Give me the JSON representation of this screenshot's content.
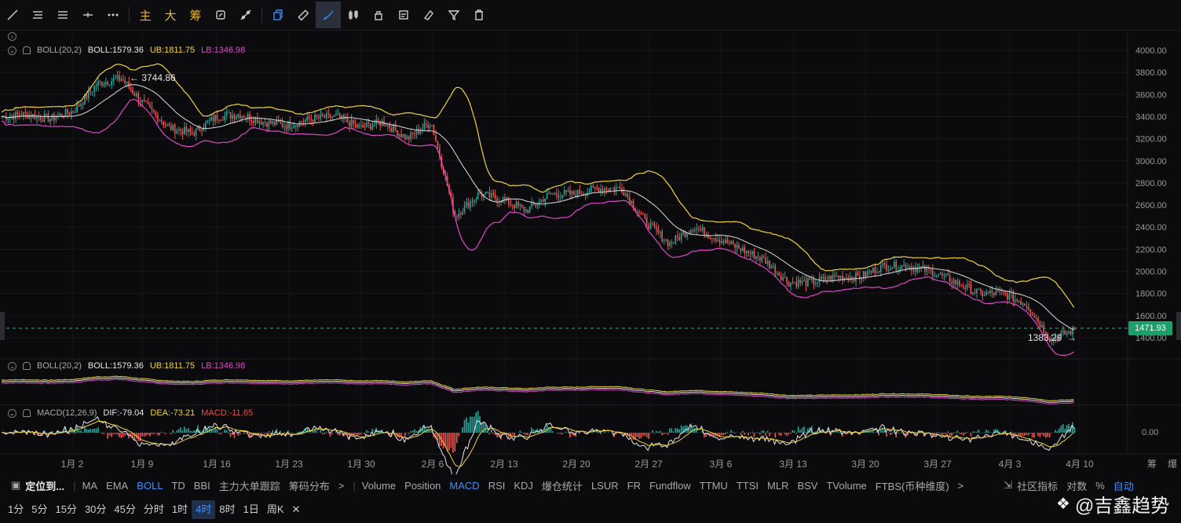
{
  "toolbar": {
    "tools": [
      "trend-line-icon",
      "horizontal-lines-icon",
      "parallel-lines-icon",
      "crosshair-icon",
      "more-dots-icon"
    ],
    "text_tools": [
      "主",
      "大",
      "筹"
    ],
    "right_tools": [
      "magnet-icon",
      "copy-icon",
      "ruler-icon",
      "brush-icon",
      "candle-icon",
      "lock-icon",
      "note-icon",
      "eraser-icon",
      "filter-icon",
      "trash-icon"
    ]
  },
  "legend_main": {
    "name": "BOLL(20,2)",
    "boll": "BOLL:1579.36",
    "ub": "UB:1811.75",
    "lb": "LB:1346.98"
  },
  "legend_sub1": {
    "name": "BOLL(20,2)",
    "boll": "BOLL:1579.36",
    "ub": "UB:1811.75",
    "lb": "LB:1346.98"
  },
  "legend_macd": {
    "name": "MACD(12,26,9)",
    "dif": "DIF:-79.04",
    "dea": "DEA:-73.21",
    "macd": "MACD:-11.65"
  },
  "annotations": {
    "high": "3744.86",
    "low": "1383.29",
    "current_price": "1471.93"
  },
  "y_ticks": [
    "4000.00",
    "3800.00",
    "3600.00",
    "3400.00",
    "3200.00",
    "3000.00",
    "2800.00",
    "2600.00",
    "2400.00",
    "2200.00",
    "2000.00",
    "1800.00",
    "1600.00",
    "1400.00"
  ],
  "macd_tick": "0.00",
  "x_ticks": [
    "1月 2",
    "1月 9",
    "1月 16",
    "1月 23",
    "1月 30",
    "2月 6",
    "2月 13",
    "2月 20",
    "2月 27",
    "3月 6",
    "3月 13",
    "3月 20",
    "3月 27",
    "4月 3",
    "4月 10"
  ],
  "axis_corner": [
    "筹",
    "爆"
  ],
  "indicator_bar": {
    "locate": "定位到...",
    "items": [
      "MA",
      "EMA",
      "BOLL",
      "TD",
      "BBI",
      "主力大单跟踪",
      "筹码分布",
      ">",
      "Volume",
      "Position",
      "MACD",
      "RSI",
      "KDJ",
      "爆仓统计",
      "LSUR",
      "FR",
      "Fundflow",
      "TTMU",
      "TTSI",
      "MLR",
      "BSV",
      "TVolume",
      "FTBS(币种维度)",
      ">"
    ],
    "active": [
      "BOLL",
      "MACD"
    ],
    "right": [
      "社区指标",
      "对数",
      "%",
      "自动"
    ]
  },
  "timeframes": {
    "items": [
      "1分",
      "5分",
      "15分",
      "30分",
      "45分",
      "分时",
      "1时",
      "4时",
      "8时",
      "1日",
      "周K"
    ],
    "active": "4时",
    "close": "✕"
  },
  "watermark": "@吉鑫趋势",
  "colors": {
    "up": "#26a69a",
    "down": "#ef5350",
    "ub": "#f0d43a",
    "lb": "#e048c8",
    "mid": "#dddddd",
    "accent": "#3b8fff"
  },
  "chart_data": {
    "type": "candlestick",
    "ylim": [
      1300,
      4050
    ],
    "x_labels": [
      "1月 2",
      "1月 9",
      "1月 16",
      "1月 23",
      "1月 30",
      "2月 6",
      "2月 13",
      "2月 20",
      "2月 27",
      "3月 6",
      "3月 13",
      "3月 20",
      "3月 27",
      "4月 3",
      "4月 10"
    ],
    "close_path": [
      3400,
      3420,
      3380,
      3450,
      3700,
      3744,
      3500,
      3300,
      3250,
      3400,
      3420,
      3350,
      3320,
      3380,
      3400,
      3300,
      3350,
      3200,
      3350,
      2500,
      2700,
      2650,
      2550,
      2700,
      2700,
      2750,
      2750,
      2450,
      2250,
      2400,
      2300,
      2200,
      2100,
      1900,
      1900,
      1950,
      1950,
      2050,
      2050,
      2000,
      1900,
      1800,
      1800,
      1700,
      1383,
      1471
    ],
    "series": [
      {
        "name": "BOLL",
        "last": 1579.36
      },
      {
        "name": "UB",
        "last": 1811.75
      },
      {
        "name": "LB",
        "last": 1346.98
      }
    ],
    "macd": {
      "dif": -79.04,
      "dea": -73.21,
      "macd": -11.65
    }
  }
}
